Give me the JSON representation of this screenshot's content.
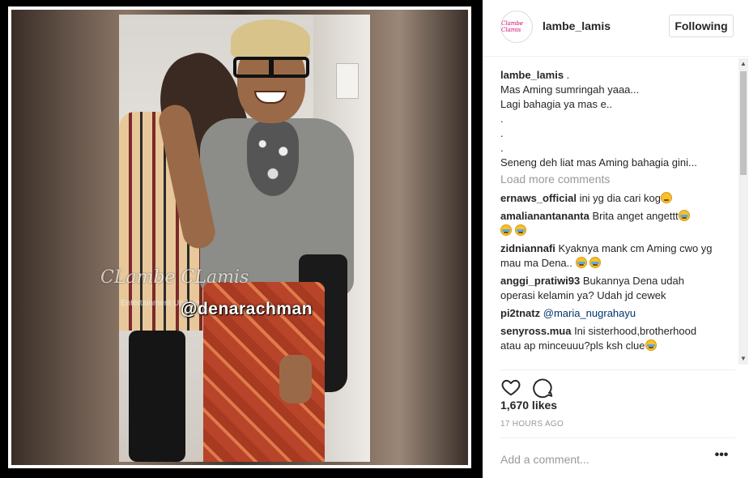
{
  "post": {
    "image_alt": "Photo of two people posing",
    "watermark": "CLambe CLamis",
    "watermark_sub": "Entertainment Update",
    "tag": "@denarachman"
  },
  "header": {
    "avatar_text": "Clambe Clamis",
    "username": "lambe_lamis",
    "follow_label": "Following"
  },
  "caption": {
    "username": "lambe_lamis",
    "suffix": " .",
    "lines": [
      "Mas Aming sumringah yaaa...",
      "Lagi bahagia ya mas e..",
      ".",
      ".",
      ".",
      "Seneng deh liat mas Aming bahagia gini..."
    ]
  },
  "load_more": "Load more comments",
  "comments": [
    {
      "user": "ernaws_official",
      "text": "ini yg dia cari kog"
    },
    {
      "user": "amalianantananta",
      "text": "Brita anget angettt"
    },
    {
      "user": "zidniannafi",
      "text": "Kyaknya mank cm Aming cwo yg mau ma Dena.."
    },
    {
      "user": "anggi_pratiwi93",
      "text": "Bukannya Dena udah operasi kelamin ya? Udah jd cewek"
    },
    {
      "user": "pi2tnatz",
      "text": "@maria_nugrahayu"
    },
    {
      "user": "senyross.mua",
      "text": "Ini sisterhood,brotherhood atau ap minceuuu?pls ksh clue"
    }
  ],
  "icons": {
    "like": "heart-icon",
    "comment": "comment-icon",
    "more": "more-options-icon"
  },
  "likes": "1,670 likes",
  "time": "17 HOURS AGO",
  "comment_input": {
    "placeholder": "Add a comment...",
    "value": ""
  },
  "more_label": "•••",
  "scroll": {
    "up": "▲",
    "down": "▼"
  },
  "colors": {
    "mention": "#003569",
    "muted": "#999999",
    "text": "#262626"
  }
}
